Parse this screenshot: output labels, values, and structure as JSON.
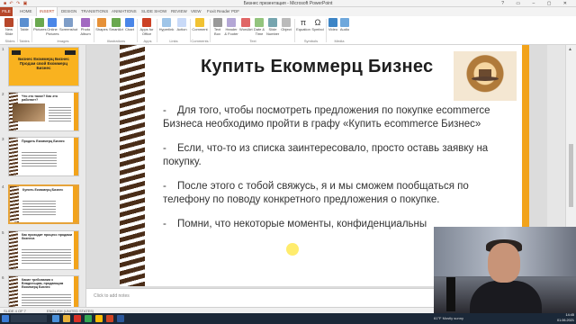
{
  "window": {
    "title": "Бизнес презентация - Microsoft PowerPoint",
    "controls": "? ▭ – ▢ ✕"
  },
  "tabs": [
    "FILE",
    "HOME",
    "INSERT",
    "DESIGN",
    "TRANSITIONS",
    "ANIMATIONS",
    "SLIDE SHOW",
    "REVIEW",
    "VIEW",
    "Foxit Reader PDF"
  ],
  "active_tab": "INSERT",
  "ribbon": {
    "buttons": [
      "New Slide",
      "Table",
      "Pictures",
      "Online Pictures",
      "Screenshot",
      "Photo Album",
      "Shapes",
      "SmartArt",
      "Chart",
      "Apps for Office",
      "Hyperlink",
      "Action",
      "Comment",
      "Text Box",
      "Header & Footer",
      "WordArt",
      "Date & Time",
      "Slide Number",
      "Object",
      "Equation",
      "Symbol",
      "Video",
      "Audio"
    ],
    "groups": [
      "Slides",
      "Tables",
      "Images",
      "Illustrations",
      "Apps",
      "Links",
      "Comments",
      "Text",
      "Symbols",
      "Media"
    ]
  },
  "thumbnails": [
    {
      "num": "1",
      "title": "Бизнес Екоммерц Бизнес Продам свой Екоммерц Бизнес",
      "logo_left": "amz",
      "logo_right": "amazon"
    },
    {
      "num": "2",
      "title": "Что это такое? Как это работает?"
    },
    {
      "num": "3",
      "title": "Продать Екоммерц Бизнес"
    },
    {
      "num": "4",
      "title": "Купить Екоммерц Бизнес"
    },
    {
      "num": "5",
      "title": "Как проходит процесс продажи бизнеса"
    },
    {
      "num": "6",
      "title": "Какие требования к Владельцам, продающим Екоммерц Бизнес"
    }
  ],
  "slide": {
    "title": "Купить Екоммерц Бизнес",
    "paragraphs": [
      {
        "bullet": "-",
        "text": "Для того, чтобы посмотреть предложения по покупке ecommerce Бизнеса необходимо пройти в графу «Купить ecommerce Бизнес»"
      },
      {
        "bullet": "-",
        "text": "Если, что-то из списка заинтересовало, просто оставь заявку на покупку."
      },
      {
        "bullet": "-",
        "text": "После этого с тобой свяжусь, я и мы сможем пообщаться по телефону по поводу конкретного предложения о покупке."
      },
      {
        "bullet": "-",
        "text": "Помни, что некоторые моменты, конфиденциальны"
      }
    ]
  },
  "notes_placeholder": "Click to add notes",
  "status": {
    "slide_of": "SLIDE 4 OF 7",
    "language": "ENGLISH (UNITED STATES)"
  },
  "taskbar": {
    "weather": "61°F  Mostly sunny",
    "time": "14:45",
    "date": "01.06.2021"
  }
}
